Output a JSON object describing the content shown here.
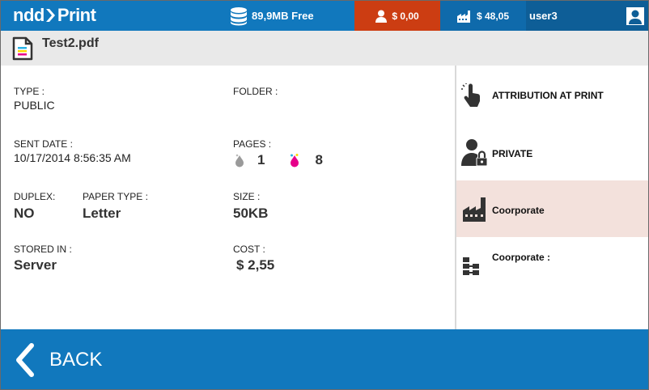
{
  "topbar": {
    "logo_part1": "ndd",
    "logo_part2": "Print",
    "storage_free": "89,9MB Free",
    "user_balance": "$ 0,00",
    "cost_center_balance": "$ 48,05",
    "username": "user3"
  },
  "file": {
    "name": "Test2.pdf",
    "icon": "document-color-icon"
  },
  "details": {
    "type_label": "TYPE :",
    "type_value": "PUBLIC",
    "folder_label": "FOLDER :",
    "folder_value": "",
    "sent_date_label": "SENT DATE :",
    "sent_date_value": "10/17/2014 8:56:35 AM",
    "pages_label": "PAGES :",
    "pages_mono": "1",
    "pages_color": "8",
    "duplex_label": "DUPLEX:",
    "duplex_value": "NO",
    "paper_type_label": "PAPER TYPE :",
    "paper_type_value": "Letter",
    "size_label": "SIZE :",
    "size_value": "50KB",
    "stored_in_label": "STORED IN :",
    "stored_in_value": "Server",
    "cost_label": "COST :",
    "cost_value": "$ 2,55"
  },
  "options": [
    {
      "label": "ATTRIBUTION AT PRINT",
      "icon": "hand-pointer-icon"
    },
    {
      "label": "PRIVATE",
      "icon": "user-lock-icon"
    },
    {
      "label": "Coorporate",
      "icon": "factory-icon"
    },
    {
      "label": "Coorporate :",
      "icon": "hierarchy-icon"
    }
  ],
  "footer": {
    "back_label": "BACK"
  },
  "colors": {
    "primary": "#1178bd",
    "balance": "#cc3d12",
    "active_option": "#f3e1dc"
  }
}
